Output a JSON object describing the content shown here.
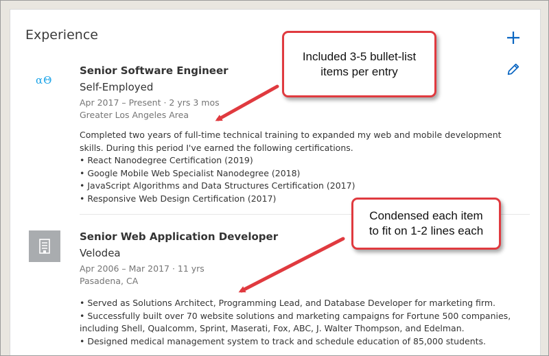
{
  "section": {
    "title": "Experience",
    "add_icon": "plus-icon",
    "edit_icon": "pencil-icon"
  },
  "entries": [
    {
      "logo_text": "αΘ",
      "title": "Senior Software Engineer",
      "company": "Self-Employed",
      "dates": "Apr 2017 – Present · 2 yrs 3 mos",
      "location": "Greater Los Angeles Area",
      "description": [
        "Completed two years of full-time technical training to expanded my web and mobile development",
        "skills. During this period I've earned the following certifications.",
        "• React Nanodegree Certification (2019)",
        "• Google Mobile Web Specialist Nanodegree (2018)",
        "• JavaScript Algorithms and Data Structures Certification (2017)",
        "• Responsive Web Design Certification (2017)"
      ]
    },
    {
      "logo_icon": "building-icon",
      "title": "Senior Web Application Developer",
      "company": "Velodea",
      "dates": "Apr 2006 – Mar 2017 · 11 yrs",
      "location": "Pasadena, CA",
      "description": [
        "• Served as Solutions Architect, Programming Lead, and Database Developer for marketing firm.",
        "• Successfully built over 70 website solutions and marketing campaigns for Fortune 500 companies,",
        "including Shell, Qualcomm, Sprint, Maserati, Fox, ABC, J. Walter Thompson, and Edelman.",
        "• Designed medical management system to track and schedule education of 85,000 students."
      ]
    }
  ],
  "callouts": [
    {
      "lines": [
        "Included 3-5 bullet-list",
        "items per entry"
      ]
    },
    {
      "lines": [
        "Condensed each item",
        "to fit on 1-2 lines each"
      ]
    }
  ],
  "colors": {
    "accent": "#0a66c2",
    "callout_border": "#e03a3f",
    "logo_blue": "#1aa3e8"
  }
}
